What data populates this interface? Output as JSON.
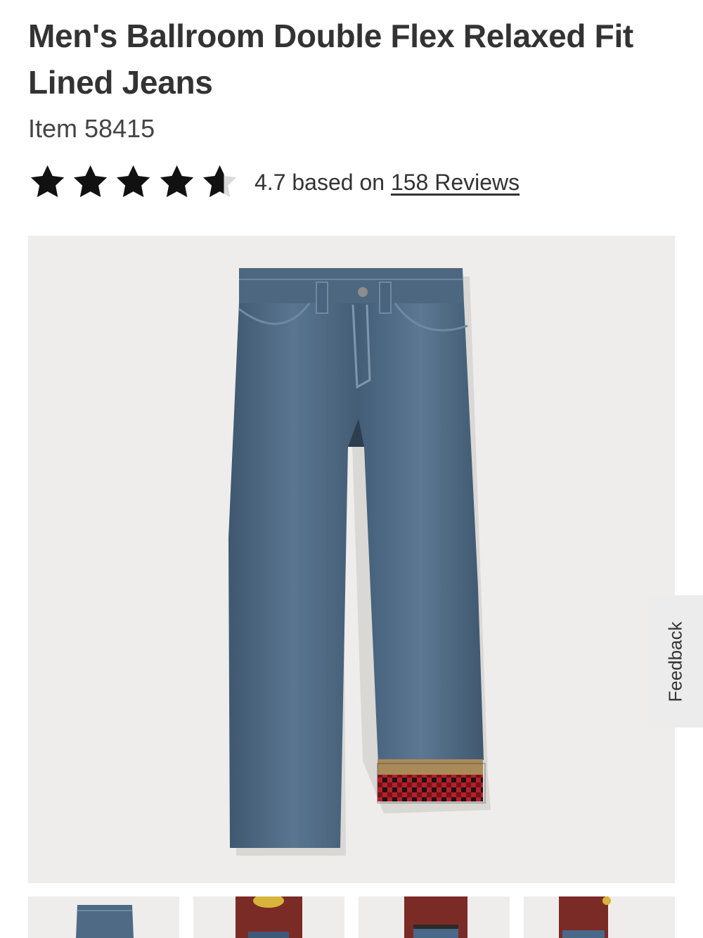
{
  "product": {
    "title": "Men's Ballroom Double Flex Relaxed Fit Lined Jeans",
    "item_number": "Item 58415"
  },
  "rating": {
    "value": 4.7,
    "max": 5,
    "text_prefix": "4.7 based on",
    "reviews_link": "158 Reviews"
  },
  "feedback": {
    "label": "Feedback"
  },
  "gallery": {
    "main_image": "jeans-flat-lay",
    "thumbnails": [
      "jeans-flat-lay",
      "model-front",
      "model-front-belt",
      "model-side"
    ]
  },
  "colors": {
    "text": "#333333",
    "image_bg": "#eeedeb",
    "denim": "#4b6680",
    "flannel_red": "#b5202a"
  }
}
